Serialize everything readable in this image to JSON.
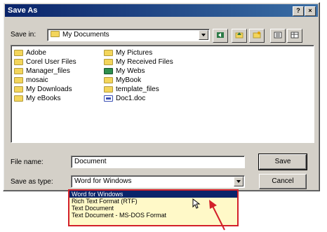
{
  "window": {
    "title": "Save As"
  },
  "title_buttons": {
    "help": "?",
    "close": "×"
  },
  "save_in": {
    "label": "Save in:",
    "value": "My Documents"
  },
  "files": [
    {
      "name": "Adobe",
      "icon": "folder-icon"
    },
    {
      "name": "Corel User Files",
      "icon": "folder-icon"
    },
    {
      "name": "Manager_files",
      "icon": "folder-icon"
    },
    {
      "name": "mosaic",
      "icon": "folder-icon"
    },
    {
      "name": "My Downloads",
      "icon": "folder-icon"
    },
    {
      "name": "My eBooks",
      "icon": "folder-icon"
    },
    {
      "name": "My Pictures",
      "icon": "folder-icon"
    },
    {
      "name": "My Received Files",
      "icon": "folder-icon"
    },
    {
      "name": "My Webs",
      "icon": "web-folder-icon"
    },
    {
      "name": "MyBook",
      "icon": "folder-icon"
    },
    {
      "name": "template_files",
      "icon": "folder-icon"
    },
    {
      "name": "Doc1.doc",
      "icon": "document-icon"
    }
  ],
  "file_name": {
    "label": "File name:",
    "value": "Document"
  },
  "save_as_type": {
    "label": "Save as type:",
    "value": "Word for Windows"
  },
  "buttons": {
    "save": "Save",
    "cancel": "Cancel"
  },
  "dropdown_options": [
    "Word for Windows",
    "Rich Text Format (RTF)",
    "Text Document",
    "Text Document - MS-DOS Format"
  ],
  "colors": {
    "annotation": "#d3202a",
    "dropdown_bg": "#fff9c8",
    "selection": "#0a246a"
  }
}
